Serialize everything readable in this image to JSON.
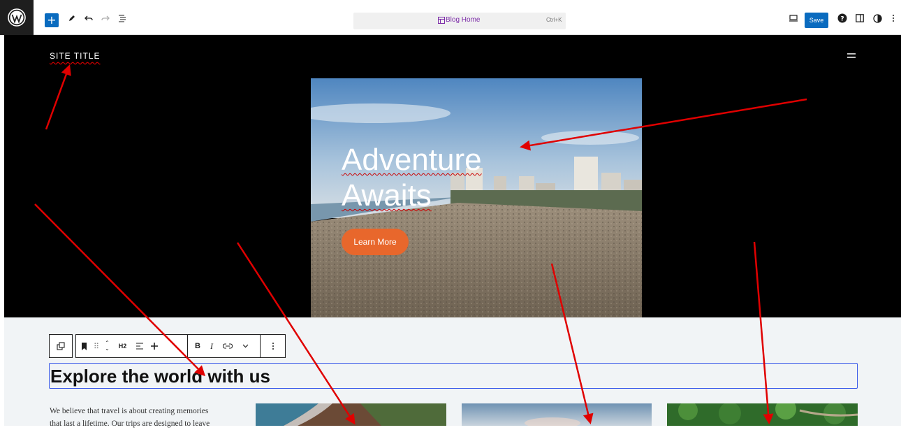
{
  "editor": {
    "doc_title": "Blog Home",
    "shortcut": "Ctrl+K",
    "save_label": "Save"
  },
  "icons": {
    "logo": "wordpress-logo",
    "add": "plus-icon",
    "tools": "pencil-icon",
    "undo": "undo-icon",
    "redo": "redo-icon",
    "document_overview": "list-view-icon",
    "view": "desktop-view-icon",
    "help": "help-icon",
    "settings": "sidebar-icon",
    "styles": "half-circle-icon",
    "options": "more-vertical-icon"
  },
  "site": {
    "title": "SITE TITLE"
  },
  "hero": {
    "heading_line1": "Adventure",
    "heading_line2": "Awaits",
    "button_label": "Learn More"
  },
  "block_toolbar": {
    "heading_level": "H2",
    "bold": "B",
    "italic": "I"
  },
  "section": {
    "heading": "Explore the world with us",
    "intro_line1": "We believe that travel is about creating memories",
    "intro_line2": "that last a lifetime. Our trips are designed to leave"
  },
  "colors": {
    "accent_blue": "#0a6bbf",
    "button_orange": "#e8672c",
    "annotation_red": "#e00000",
    "doc_title_purple": "#7b2aa8"
  }
}
